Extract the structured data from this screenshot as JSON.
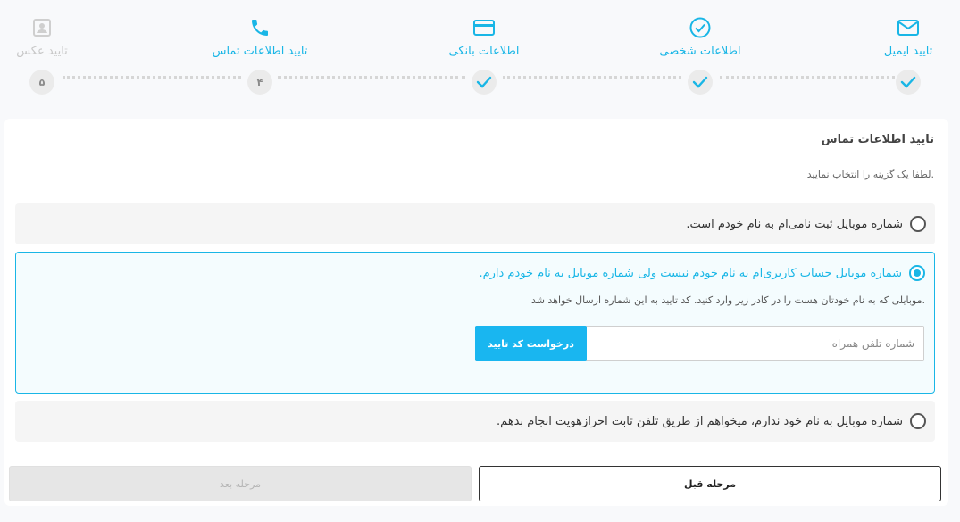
{
  "steps": [
    {
      "label": "تایید ایمیل",
      "icon": "mail-icon",
      "status": "done"
    },
    {
      "label": "اطلاعات شخصی",
      "icon": "check-circle-icon",
      "status": "done"
    },
    {
      "label": "اطلاعات بانکی",
      "icon": "credit-card-icon",
      "status": "done"
    },
    {
      "label": "تایید اطلاعات تماس",
      "icon": "phone-icon",
      "status": "current",
      "number": "۴"
    },
    {
      "label": "تایید عکس",
      "icon": "portrait-icon",
      "status": "disabled",
      "number": "۵"
    }
  ],
  "colors": {
    "accent": "#19b6e6",
    "button": "#19b6f0"
  },
  "form": {
    "title": "تایید اطلاعات تماس",
    "subtitle": "لطفا یک گزینه را انتخاب نمایید.",
    "options": [
      {
        "label": "شماره موبایل ثبت نامی‌ام به نام خودم است.",
        "selected": false
      },
      {
        "label": "شماره موبایل حساب کاربری‌ام به نام خودم نیست ولی شماره موبایل به نام خودم دارم.",
        "selected": true,
        "hint": "موبایلی که به نام خودتان هست را در کادر زیر وارد کنید. کد تایید به این شماره ارسال خواهد شد.",
        "phone_placeholder": "شماره تلفن همراه",
        "phone_value": "",
        "request_button": "درخواست کد تایید"
      },
      {
        "label": "شماره موبایل به نام خود ندارم، میخواهم از طریق تلفن ثابت احرازهویت انجام بدهم.",
        "selected": false
      }
    ],
    "prev_button": "مرحله قبل",
    "next_button": "مرحله بعد"
  }
}
